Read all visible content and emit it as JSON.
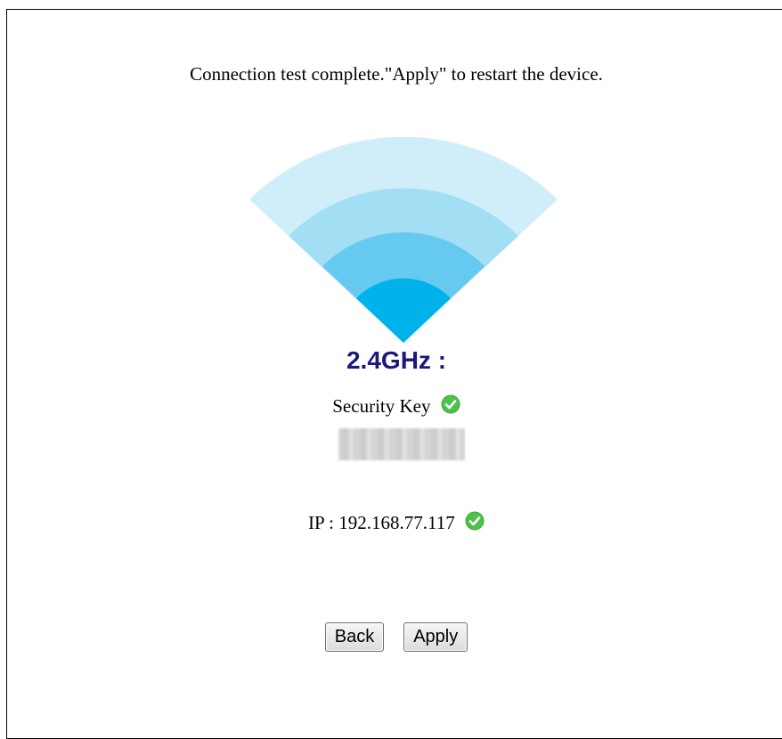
{
  "message": "Connection test complete.\"Apply\" to restart the device.",
  "band_label": "2.4GHz :",
  "security_key_label": "Security Key",
  "ip_text": "IP : 192.168.77.117",
  "buttons": {
    "back": "Back",
    "apply": "Apply"
  },
  "colors": {
    "wifi_arc_1": "#d0eef9",
    "wifi_arc_2": "#a2dff5",
    "wifi_arc_3": "#66c9ef",
    "wifi_arc_4": "#00b2ea",
    "band_text": "#1a1a7a",
    "check_green": "#4cc24c"
  },
  "icons": {
    "wifi": "wifi-signal-icon",
    "security_status": "check-icon",
    "ip_status": "check-icon"
  }
}
